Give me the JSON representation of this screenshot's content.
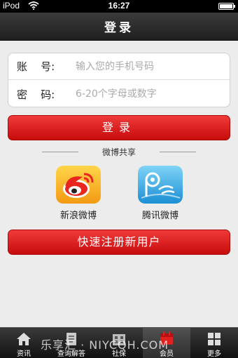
{
  "status_bar": {
    "carrier": "iPod",
    "time": "16:27",
    "battery_level": 1.0
  },
  "header": {
    "title": "登录"
  },
  "form": {
    "account_label": "账    号:",
    "account_placeholder": "输入您的手机号码",
    "password_label": "密    码:",
    "password_placeholder": "6-20个字母或数字"
  },
  "login_button": {
    "label": "登录"
  },
  "share": {
    "heading": "微博共享",
    "items": [
      {
        "name": "新浪微博",
        "icon": "sina-weibo-icon"
      },
      {
        "name": "腾讯微博",
        "icon": "tencent-weibo-icon"
      }
    ]
  },
  "register_button": {
    "label": "快速注册新用户"
  },
  "tab_bar": {
    "items": [
      {
        "label": "资讯",
        "icon": "home-icon"
      },
      {
        "label": "查询解答",
        "icon": "document-icon"
      },
      {
        "label": "社保",
        "icon": "building-icon"
      },
      {
        "label": "会员",
        "icon": "calendar-icon",
        "active": true
      },
      {
        "label": "更多",
        "icon": "grid-icon"
      }
    ]
  },
  "watermark": "乐享汇 · NIYCQH.COM",
  "colors": {
    "accent_red": "#e01e1e",
    "nav_dark": "#2a2a2a",
    "background": "#ececec"
  }
}
